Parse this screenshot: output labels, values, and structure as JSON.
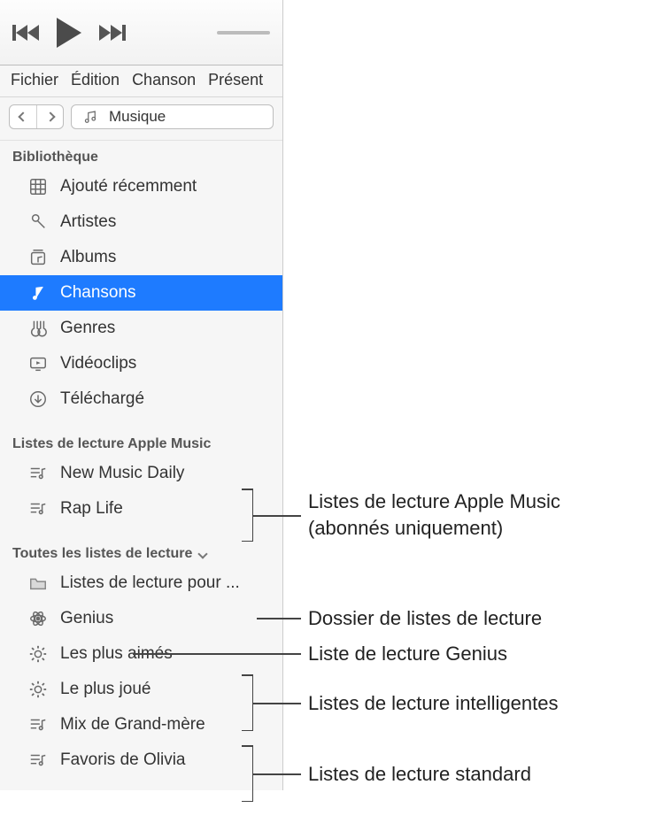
{
  "menubar": {
    "items": [
      "Fichier",
      "Édition",
      "Chanson",
      "Présent"
    ]
  },
  "nav": {
    "media_label": "Musique"
  },
  "sections": {
    "library_head": "Bibliothèque",
    "library_items": [
      {
        "label": "Ajouté récemment",
        "icon": "grid"
      },
      {
        "label": "Artistes",
        "icon": "mic"
      },
      {
        "label": "Albums",
        "icon": "album"
      },
      {
        "label": "Chansons",
        "icon": "note",
        "selected": true
      },
      {
        "label": "Genres",
        "icon": "guitar"
      },
      {
        "label": "Vidéoclips",
        "icon": "video"
      },
      {
        "label": "Téléchargé",
        "icon": "download"
      }
    ],
    "applemusic_head": "Listes de lecture Apple Music",
    "applemusic_items": [
      {
        "label": "New Music Daily"
      },
      {
        "label": "Rap Life"
      }
    ],
    "all_head": "Toutes les listes de lecture",
    "all_items": [
      {
        "label": "Listes de lecture pour ...",
        "icon": "folder"
      },
      {
        "label": "Genius",
        "icon": "atom"
      },
      {
        "label": "Les plus aimés",
        "icon": "gear"
      },
      {
        "label": "Le plus joué",
        "icon": "gear"
      },
      {
        "label": "Mix de Grand-mère",
        "icon": "playlist"
      },
      {
        "label": "Favoris de Olivia",
        "icon": "playlist"
      }
    ]
  },
  "callouts": {
    "apple_music": "Listes de lecture Apple Music\n(abonnés uniquement)",
    "folder": "Dossier de listes de lecture",
    "genius": "Liste de lecture Genius",
    "smart": "Listes de lecture intelligentes",
    "standard": "Listes de lecture standard"
  }
}
